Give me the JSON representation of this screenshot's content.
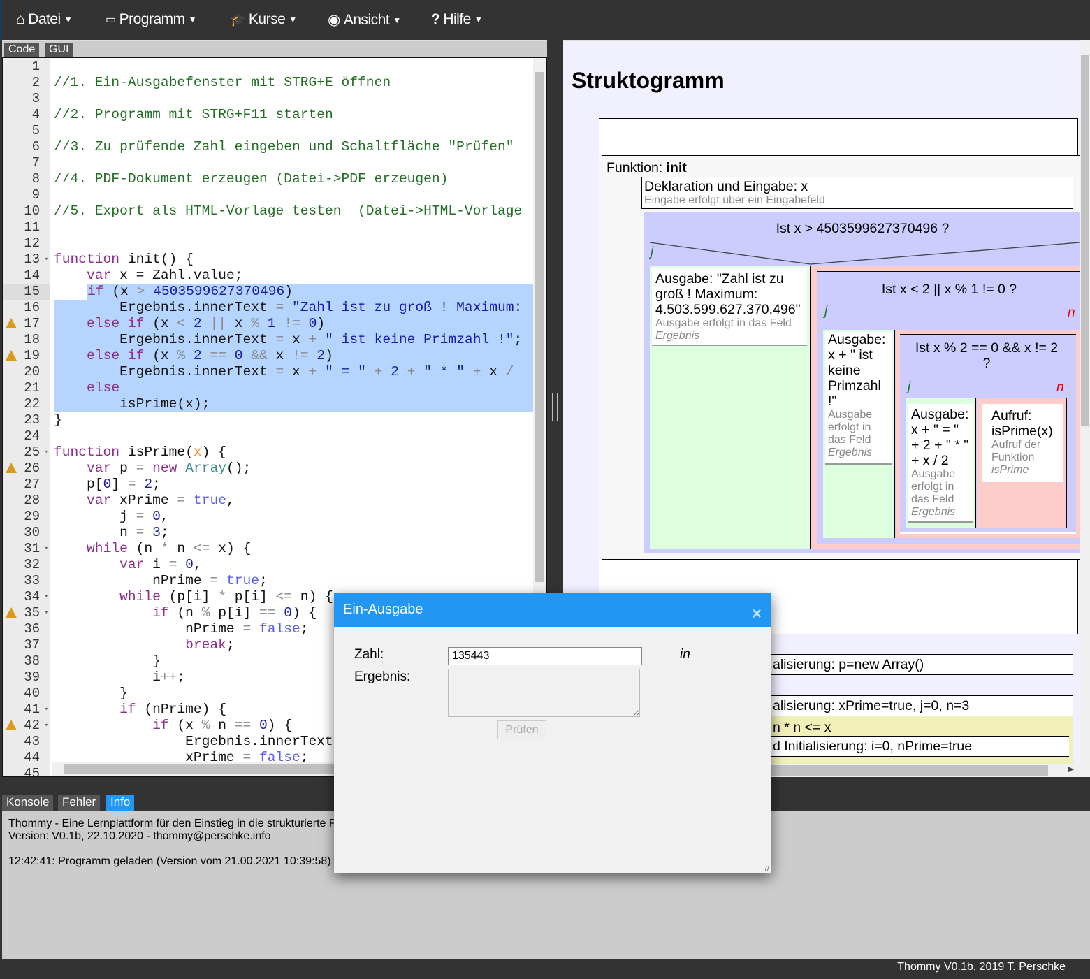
{
  "nav": {
    "menus": [
      {
        "label": "Datei",
        "icon": "home-icon",
        "glyph": "⌂"
      },
      {
        "label": "Programm",
        "icon": "laptop-icon",
        "glyph": "💻"
      },
      {
        "label": "Kurse",
        "icon": "graduation-cap-icon",
        "glyph": "🎓"
      },
      {
        "label": "Ansicht",
        "icon": "eye-icon",
        "glyph": "◉"
      },
      {
        "label": "Hilfe",
        "icon": "question-icon",
        "glyph": "?"
      }
    ]
  },
  "editor_tabs": [
    "Code",
    "GUI"
  ],
  "editor": {
    "active_line": 15,
    "selected_lines": [
      15,
      16,
      17,
      18,
      19,
      20,
      21,
      22
    ],
    "warning_lines": [
      17,
      19,
      26,
      35,
      42
    ],
    "fold_lines": [
      13,
      25,
      31,
      34,
      35,
      41,
      42
    ],
    "lines": [
      [],
      [
        [
          "c",
          "//1. Ein-Ausgabefenster mit STRG+E öffnen"
        ]
      ],
      [],
      [
        [
          "c",
          "//2. Programm mit STRG+F11 starten"
        ]
      ],
      [],
      [
        [
          "c",
          "//3. Zu prüfende Zahl eingeben und Schaltfläche \"Prüfen\""
        ]
      ],
      [],
      [
        [
          "c",
          "//4. PDF-Dokument erzeugen (Datei->PDF erzeugen)"
        ]
      ],
      [],
      [
        [
          "c",
          "//5. Export als HTML-Vorlage testen  (Datei->HTML-Vorlage"
        ]
      ],
      [],
      [],
      [
        [
          "k",
          "function"
        ],
        [
          "p",
          " init() {"
        ]
      ],
      [
        [
          "p",
          "    "
        ],
        [
          "k",
          "var"
        ],
        [
          "p",
          " x = Zahl.value;"
        ]
      ],
      [
        [
          "p",
          "    "
        ],
        [
          "k",
          "if"
        ],
        [
          "p",
          " (x "
        ],
        [
          "o",
          ">"
        ],
        [
          "p",
          " "
        ],
        [
          "n",
          "4503599627370496"
        ],
        [
          "p",
          ")"
        ]
      ],
      [
        [
          "p",
          "        Ergebnis.innerText "
        ],
        [
          "o",
          "="
        ],
        [
          "p",
          " "
        ],
        [
          "s",
          "\"Zahl ist zu groß ! Maximum:"
        ]
      ],
      [
        [
          "p",
          "    "
        ],
        [
          "k",
          "else if"
        ],
        [
          "p",
          " (x "
        ],
        [
          "o",
          "<"
        ],
        [
          "n",
          " 2"
        ],
        [
          "o",
          " ||"
        ],
        [
          "p",
          " x "
        ],
        [
          "o",
          "%"
        ],
        [
          "n",
          " 1"
        ],
        [
          "o",
          " !="
        ],
        [
          "n",
          " 0"
        ],
        [
          "p",
          ")"
        ]
      ],
      [
        [
          "p",
          "        Ergebnis.innerText "
        ],
        [
          "o",
          "="
        ],
        [
          "p",
          " x "
        ],
        [
          "o",
          "+"
        ],
        [
          "p",
          " "
        ],
        [
          "s",
          "\" ist keine Primzahl !\""
        ],
        [
          "p",
          ";"
        ]
      ],
      [
        [
          "p",
          "    "
        ],
        [
          "k",
          "else if"
        ],
        [
          "p",
          " (x "
        ],
        [
          "o",
          "%"
        ],
        [
          "n",
          " 2"
        ],
        [
          "o",
          " =="
        ],
        [
          "n",
          " 0"
        ],
        [
          "o",
          " &&"
        ],
        [
          "p",
          " x "
        ],
        [
          "o",
          "!="
        ],
        [
          "n",
          " 2"
        ],
        [
          "p",
          ")"
        ]
      ],
      [
        [
          "p",
          "        Ergebnis.innerText "
        ],
        [
          "o",
          "="
        ],
        [
          "p",
          " x "
        ],
        [
          "o",
          "+"
        ],
        [
          "p",
          " "
        ],
        [
          "s",
          "\" = \""
        ],
        [
          "o",
          " + "
        ],
        [
          "n",
          "2"
        ],
        [
          "o",
          " + "
        ],
        [
          "s",
          "\" * \""
        ],
        [
          "o",
          " + "
        ],
        [
          "p",
          "x "
        ],
        [
          "o",
          "/"
        ]
      ],
      [
        [
          "p",
          "    "
        ],
        [
          "k",
          "else"
        ]
      ],
      [
        [
          "p",
          "        isPrime(x);"
        ]
      ],
      [
        [
          "p",
          "}"
        ]
      ],
      [],
      [
        [
          "k",
          "function"
        ],
        [
          "p",
          " isPrime("
        ],
        [
          "v",
          "x"
        ],
        [
          "p",
          ") {"
        ]
      ],
      [
        [
          "p",
          "    "
        ],
        [
          "k",
          "var"
        ],
        [
          "p",
          " p "
        ],
        [
          "o",
          "="
        ],
        [
          "k",
          " new"
        ],
        [
          "b",
          " Array"
        ],
        [
          "p",
          "();"
        ]
      ],
      [
        [
          "p",
          "    p["
        ],
        [
          "n",
          "0"
        ],
        [
          "p",
          "] "
        ],
        [
          "o",
          "="
        ],
        [
          "n",
          " 2"
        ],
        [
          "p",
          ";"
        ]
      ],
      [
        [
          "p",
          "    "
        ],
        [
          "k",
          "var"
        ],
        [
          "p",
          " xPrime "
        ],
        [
          "o",
          "="
        ],
        [
          "a",
          " true"
        ],
        [
          "p",
          ","
        ]
      ],
      [
        [
          "p",
          "        j "
        ],
        [
          "o",
          "="
        ],
        [
          "n",
          " 0"
        ],
        [
          "p",
          ","
        ]
      ],
      [
        [
          "p",
          "        n "
        ],
        [
          "o",
          "="
        ],
        [
          "n",
          " 3"
        ],
        [
          "p",
          ";"
        ]
      ],
      [
        [
          "p",
          "    "
        ],
        [
          "k",
          "while"
        ],
        [
          "p",
          " (n "
        ],
        [
          "o",
          "*"
        ],
        [
          "p",
          " n "
        ],
        [
          "o",
          "<="
        ],
        [
          "p",
          " x) {"
        ]
      ],
      [
        [
          "p",
          "        "
        ],
        [
          "k",
          "var"
        ],
        [
          "p",
          " i "
        ],
        [
          "o",
          "="
        ],
        [
          "n",
          " 0"
        ],
        [
          "p",
          ","
        ]
      ],
      [
        [
          "p",
          "            nPrime "
        ],
        [
          "o",
          "="
        ],
        [
          "a",
          " true"
        ],
        [
          "p",
          ";"
        ]
      ],
      [
        [
          "p",
          "        "
        ],
        [
          "k",
          "while"
        ],
        [
          "p",
          " (p[i] "
        ],
        [
          "o",
          "*"
        ],
        [
          "p",
          " p[i] "
        ],
        [
          "o",
          "<="
        ],
        [
          "p",
          " n) {"
        ]
      ],
      [
        [
          "p",
          "            "
        ],
        [
          "k",
          "if"
        ],
        [
          "p",
          " (n "
        ],
        [
          "o",
          "%"
        ],
        [
          "p",
          " p[i] "
        ],
        [
          "o",
          "=="
        ],
        [
          "n",
          " 0"
        ],
        [
          "p",
          ") {"
        ]
      ],
      [
        [
          "p",
          "                nPrime "
        ],
        [
          "o",
          "="
        ],
        [
          "a",
          " false"
        ],
        [
          "p",
          ";"
        ]
      ],
      [
        [
          "p",
          "                "
        ],
        [
          "k",
          "break"
        ],
        [
          "p",
          ";"
        ]
      ],
      [
        [
          "p",
          "            }"
        ]
      ],
      [
        [
          "p",
          "            i"
        ],
        [
          "o",
          "++"
        ],
        [
          "p",
          ";"
        ]
      ],
      [
        [
          "p",
          "        }"
        ]
      ],
      [
        [
          "p",
          "        "
        ],
        [
          "k",
          "if"
        ],
        [
          "p",
          " (nPrime) {"
        ]
      ],
      [
        [
          "p",
          "            "
        ],
        [
          "k",
          "if"
        ],
        [
          "p",
          " (x "
        ],
        [
          "o",
          "%"
        ],
        [
          "p",
          " n "
        ],
        [
          "o",
          "=="
        ],
        [
          "n",
          " 0"
        ],
        [
          "p",
          ") {"
        ]
      ],
      [
        [
          "p",
          "                Ergebnis.innerText"
        ]
      ],
      [
        [
          "p",
          "                xPrime "
        ],
        [
          "o",
          "="
        ],
        [
          "a",
          " false"
        ],
        [
          "p",
          ";"
        ]
      ],
      []
    ]
  },
  "struktogramm": {
    "title": "Struktogramm",
    "function_label": "Funktion: ",
    "function_name": "init",
    "decl_title": "Deklaration und Eingabe: x",
    "decl_sub": "Eingabe erfolgt über ein Eingabefeld",
    "if1": "Ist x > 4503599627370496 ?",
    "j": "j",
    "n": "n",
    "out1_lines": [
      "Ausgabe: \"Zahl ist zu",
      "groß ! Maximum:",
      "4.503.599.627.370.496\""
    ],
    "out1_sub": "Ausgabe erfolgt in das Feld",
    "field": "Ergebnis",
    "if2": "Ist x < 2 || x % 1 != 0 ?",
    "out2_lines": [
      "Ausgabe:",
      "x + \" ist",
      "keine",
      "Primzahl",
      "!\""
    ],
    "out_sub_lines": [
      "Ausgabe",
      "erfolgt in",
      "das Feld"
    ],
    "if3_lines": [
      "Ist x % 2 == 0 && x != 2",
      "?"
    ],
    "out3_lines": [
      "Ausgabe:",
      "x + \" = \"",
      "+ 2 + \" * \"",
      "+ x / 2"
    ],
    "call_lines": [
      "Aufruf:",
      "isPrime(x)"
    ],
    "call_sub_lines": [
      "Aufruf der",
      "Funktion"
    ],
    "call_name": "isPrime",
    "rows": [
      "alisierung: p=new Array()",
      "alisierung: xPrime=true, j=0, n=3",
      "n * n <= x",
      "d Initialisierung: i=0, nPrime=true"
    ]
  },
  "bottom_tabs": [
    {
      "label": "Konsole",
      "active": false
    },
    {
      "label": "Fehler",
      "active": false
    },
    {
      "label": "Info",
      "active": true
    }
  ],
  "console": {
    "lines": [
      "Thommy - Eine Lernplattform für den Einstieg in die strukturierte P",
      "Version: V0.1b, 22.10.2020 - thommy@perschke.info",
      "",
      "12:42:41: Programm geladen (Version vom 21.00.2021 10:39:58)"
    ]
  },
  "footer": "Thommy V0.1b, 2019 T. Perschke",
  "dialog": {
    "title": "Ein-Ausgabe",
    "close": "×",
    "zahl_label": "Zahl:",
    "zahl_value": "135443",
    "ergebnis_label": "Ergebnis:",
    "button": "Prüfen",
    "in_label": "in"
  },
  "colors": {
    "accent": "#2196f3",
    "nav": "#333333",
    "if_bg": "#ccccff",
    "yes_bg": "#ddffdd",
    "no_bg": "#ffcccc",
    "loop_bg": "#f0f0b8",
    "selection": "#b5d5ff"
  }
}
